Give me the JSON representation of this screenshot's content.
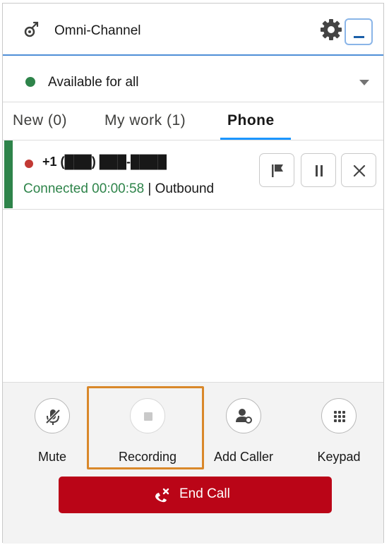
{
  "header": {
    "title": "Omni-Channel",
    "icon": "omni-channel-icon",
    "settings_icon": "gear-icon",
    "minimize_icon": "minimize-icon"
  },
  "status": {
    "label": "Available for all",
    "color": "#2e844a"
  },
  "tabs": [
    {
      "label": "New (0)"
    },
    {
      "label": "My work (1)"
    },
    {
      "label": "Phone",
      "active": true
    }
  ],
  "call": {
    "number": "+1 (███) ███-████",
    "status": "Connected 00:00:58",
    "separator": "|",
    "direction": "Outbound",
    "actions": [
      "flag-icon",
      "pause-icon",
      "close-icon"
    ]
  },
  "controls": [
    {
      "label": "Mute",
      "icon": "mute-icon"
    },
    {
      "label": "Recording",
      "icon": "stop-icon"
    },
    {
      "label": "Add Caller",
      "icon": "add-caller-icon"
    },
    {
      "label": "Keypad",
      "icon": "keypad-icon"
    }
  ],
  "end_call": {
    "label": "End Call",
    "icon": "end-call-icon",
    "color": "#ba0517"
  }
}
